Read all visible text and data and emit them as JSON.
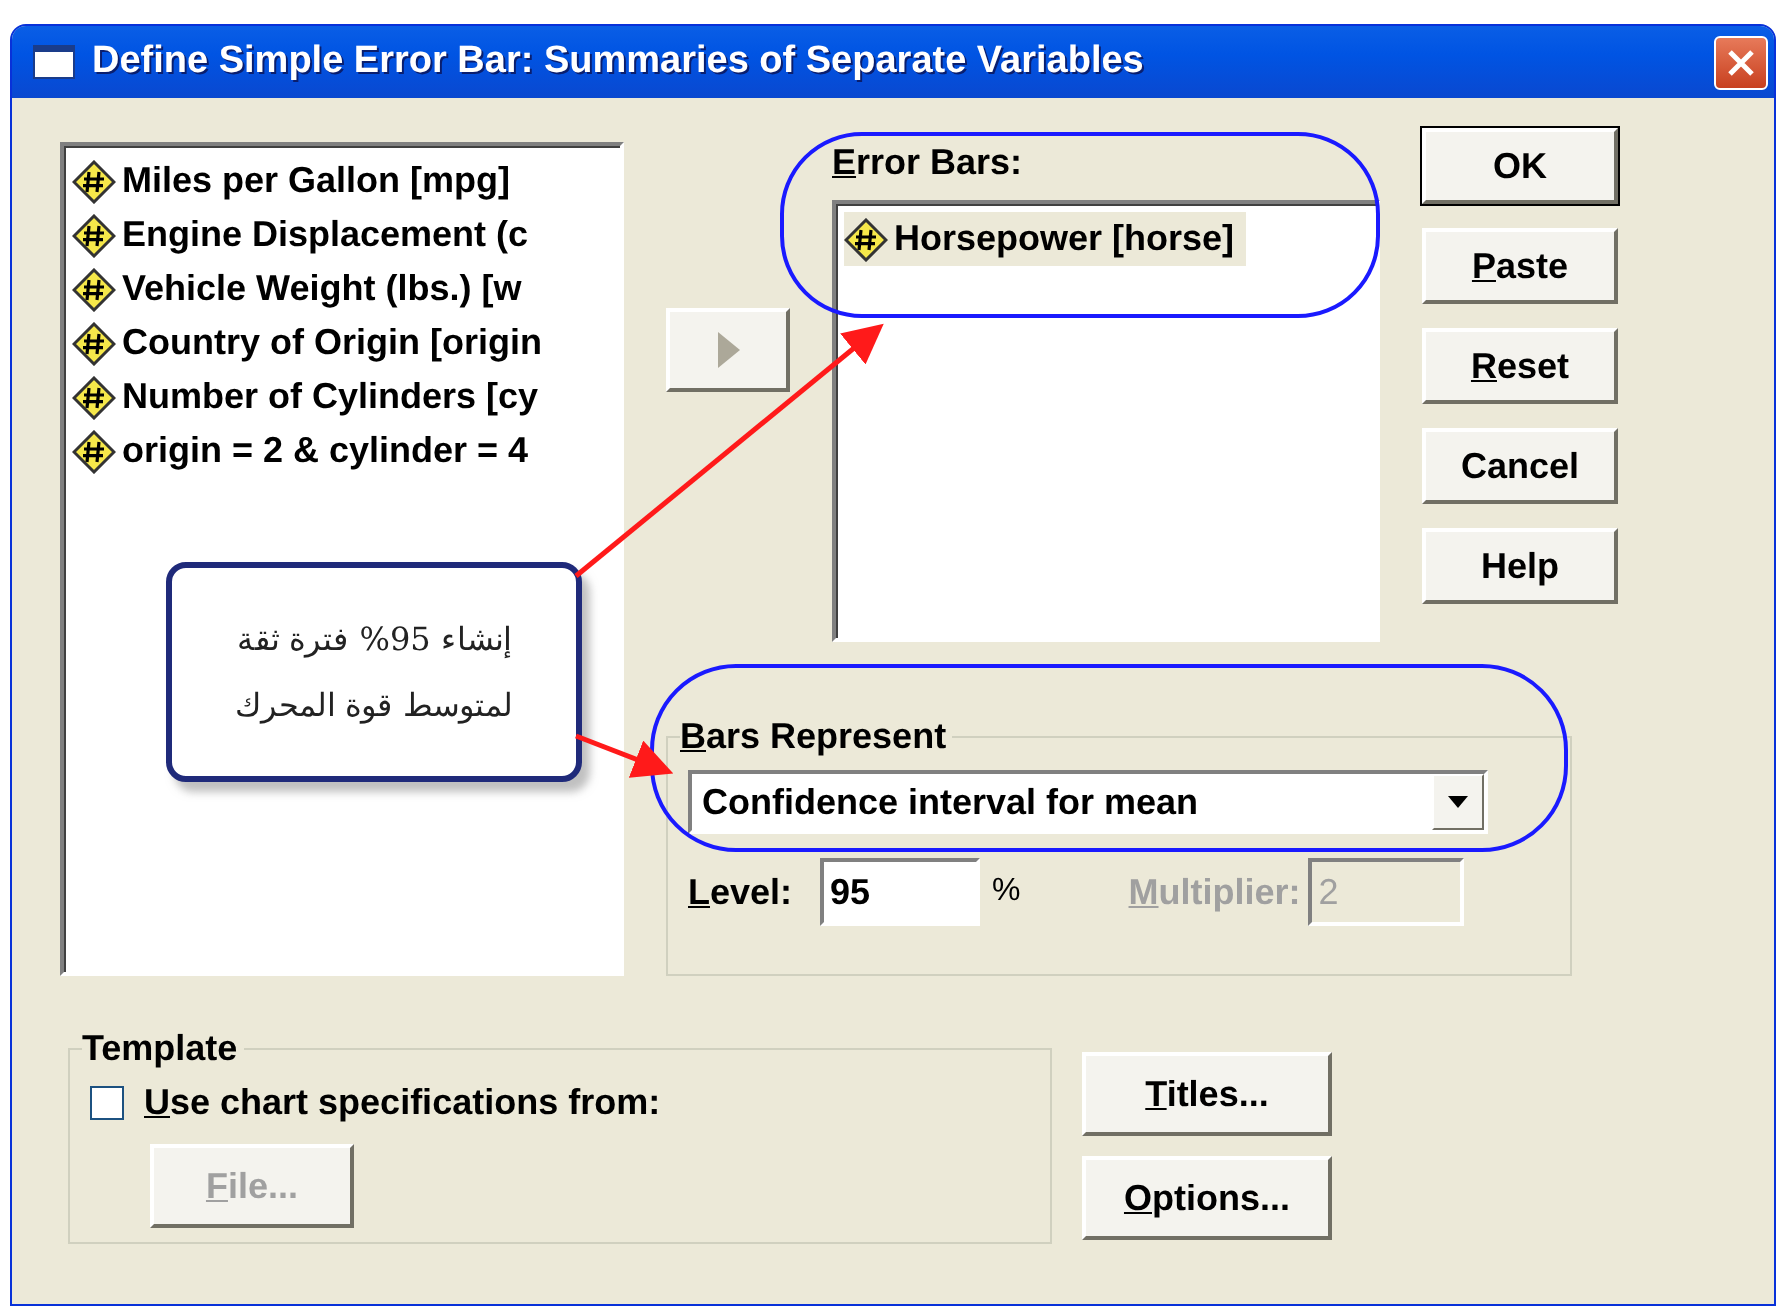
{
  "window": {
    "title": "Define Simple Error Bar: Summaries of Separate Variables"
  },
  "source_list": {
    "items": [
      {
        "label": "Miles per Gallon [mpg]",
        "selected": false
      },
      {
        "label": "Engine Displacement (c",
        "selected": false
      },
      {
        "label": "Vehicle Weight (lbs.) [w",
        "selected": false
      },
      {
        "label": "Country of Origin [origin",
        "selected": false
      },
      {
        "label": "Number of Cylinders [cy",
        "selected": false
      },
      {
        "label": "origin = 2 & cylinder = 4",
        "selected": false
      }
    ]
  },
  "move_button": {
    "disabled": true
  },
  "error_bars": {
    "label": "Error Bars:",
    "mnemonic": true,
    "items": [
      {
        "label": "Horsepower [horse]",
        "selected": true
      }
    ]
  },
  "buttons": [
    {
      "label": "OK",
      "mnemonic": false,
      "default": true
    },
    {
      "label": "Paste",
      "mnemonic": true,
      "default": false
    },
    {
      "label": "Reset",
      "mnemonic": true,
      "default": false
    },
    {
      "label": "Cancel",
      "mnemonic": false,
      "default": false
    },
    {
      "label": "Help",
      "mnemonic": false,
      "default": false
    }
  ],
  "bars_represent": {
    "label": "Bars Represent",
    "mnemonic": true,
    "value": "Confidence interval for mean",
    "level": {
      "label": "Level:",
      "mnemonic": true,
      "value": "95",
      "unit": "%",
      "disabled": false
    },
    "multiplier": {
      "label": "Multiplier:",
      "mnemonic": true,
      "value": "2",
      "disabled": true
    }
  },
  "template": {
    "label": "Template",
    "checkbox": {
      "label": "Use chart specifications from:",
      "mnemonic": true,
      "checked": false
    },
    "file_button": {
      "label": "File...",
      "mnemonic": true,
      "disabled": true
    }
  },
  "bottom_buttons": [
    {
      "label": "Titles...",
      "mnemonic": true,
      "default": false
    },
    {
      "label": "Options...",
      "mnemonic": true,
      "default": false
    }
  ],
  "annotation": {
    "lines": [
      "إنشاء 95% فترة ثقة",
      "لمتوسط قوة المحرك"
    ]
  }
}
